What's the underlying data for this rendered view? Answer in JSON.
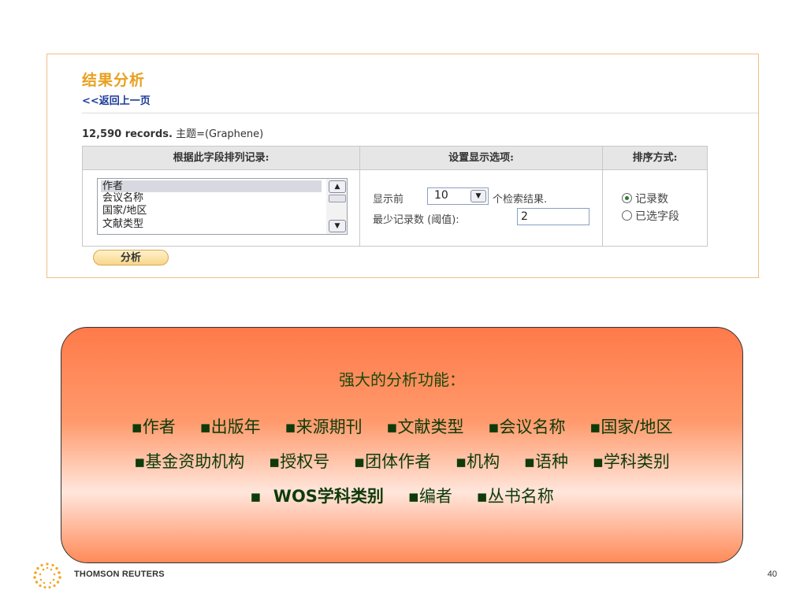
{
  "panel": {
    "title": "结果分析",
    "back_link": "<<返回上一页",
    "records_count": "12,590 records.",
    "records_query": " 主题=(Graphene)",
    "columns": {
      "sort_field": "根据此字段排列记录:",
      "display_options": "设置显示选项:",
      "sort_method": "排序方式:"
    },
    "fields": [
      "作者",
      "会议名称",
      "国家/地区",
      "文献类型"
    ],
    "show_prefix": "显示前",
    "show_count": "10",
    "show_suffix": "个检索结果.",
    "min_records_label": "最少记录数 (阈值):",
    "min_records_value": "2",
    "radio_record_count": "记录数",
    "radio_selected_field": "已选字段",
    "analyze_button": "分析"
  },
  "callout": {
    "title": "强大的分析功能：",
    "line1": [
      "▪作者",
      "▪出版年",
      "▪来源期刊",
      "▪文献类型",
      "▪会议名称",
      "▪国家/地区"
    ],
    "line2": [
      "▪基金资助机构",
      "▪授权号",
      "▪团体作者",
      "▪机构",
      "▪语种",
      "▪学科类别"
    ],
    "line3_wos": "▪ WOS学科类别",
    "line3": [
      "▪编者",
      "▪丛书名称"
    ]
  },
  "footer": {
    "brand": "THOMSON REUTERS",
    "page_number": "40",
    "logo_icon": "dotted-sphere-icon",
    "logo_color": "#f5a623"
  }
}
